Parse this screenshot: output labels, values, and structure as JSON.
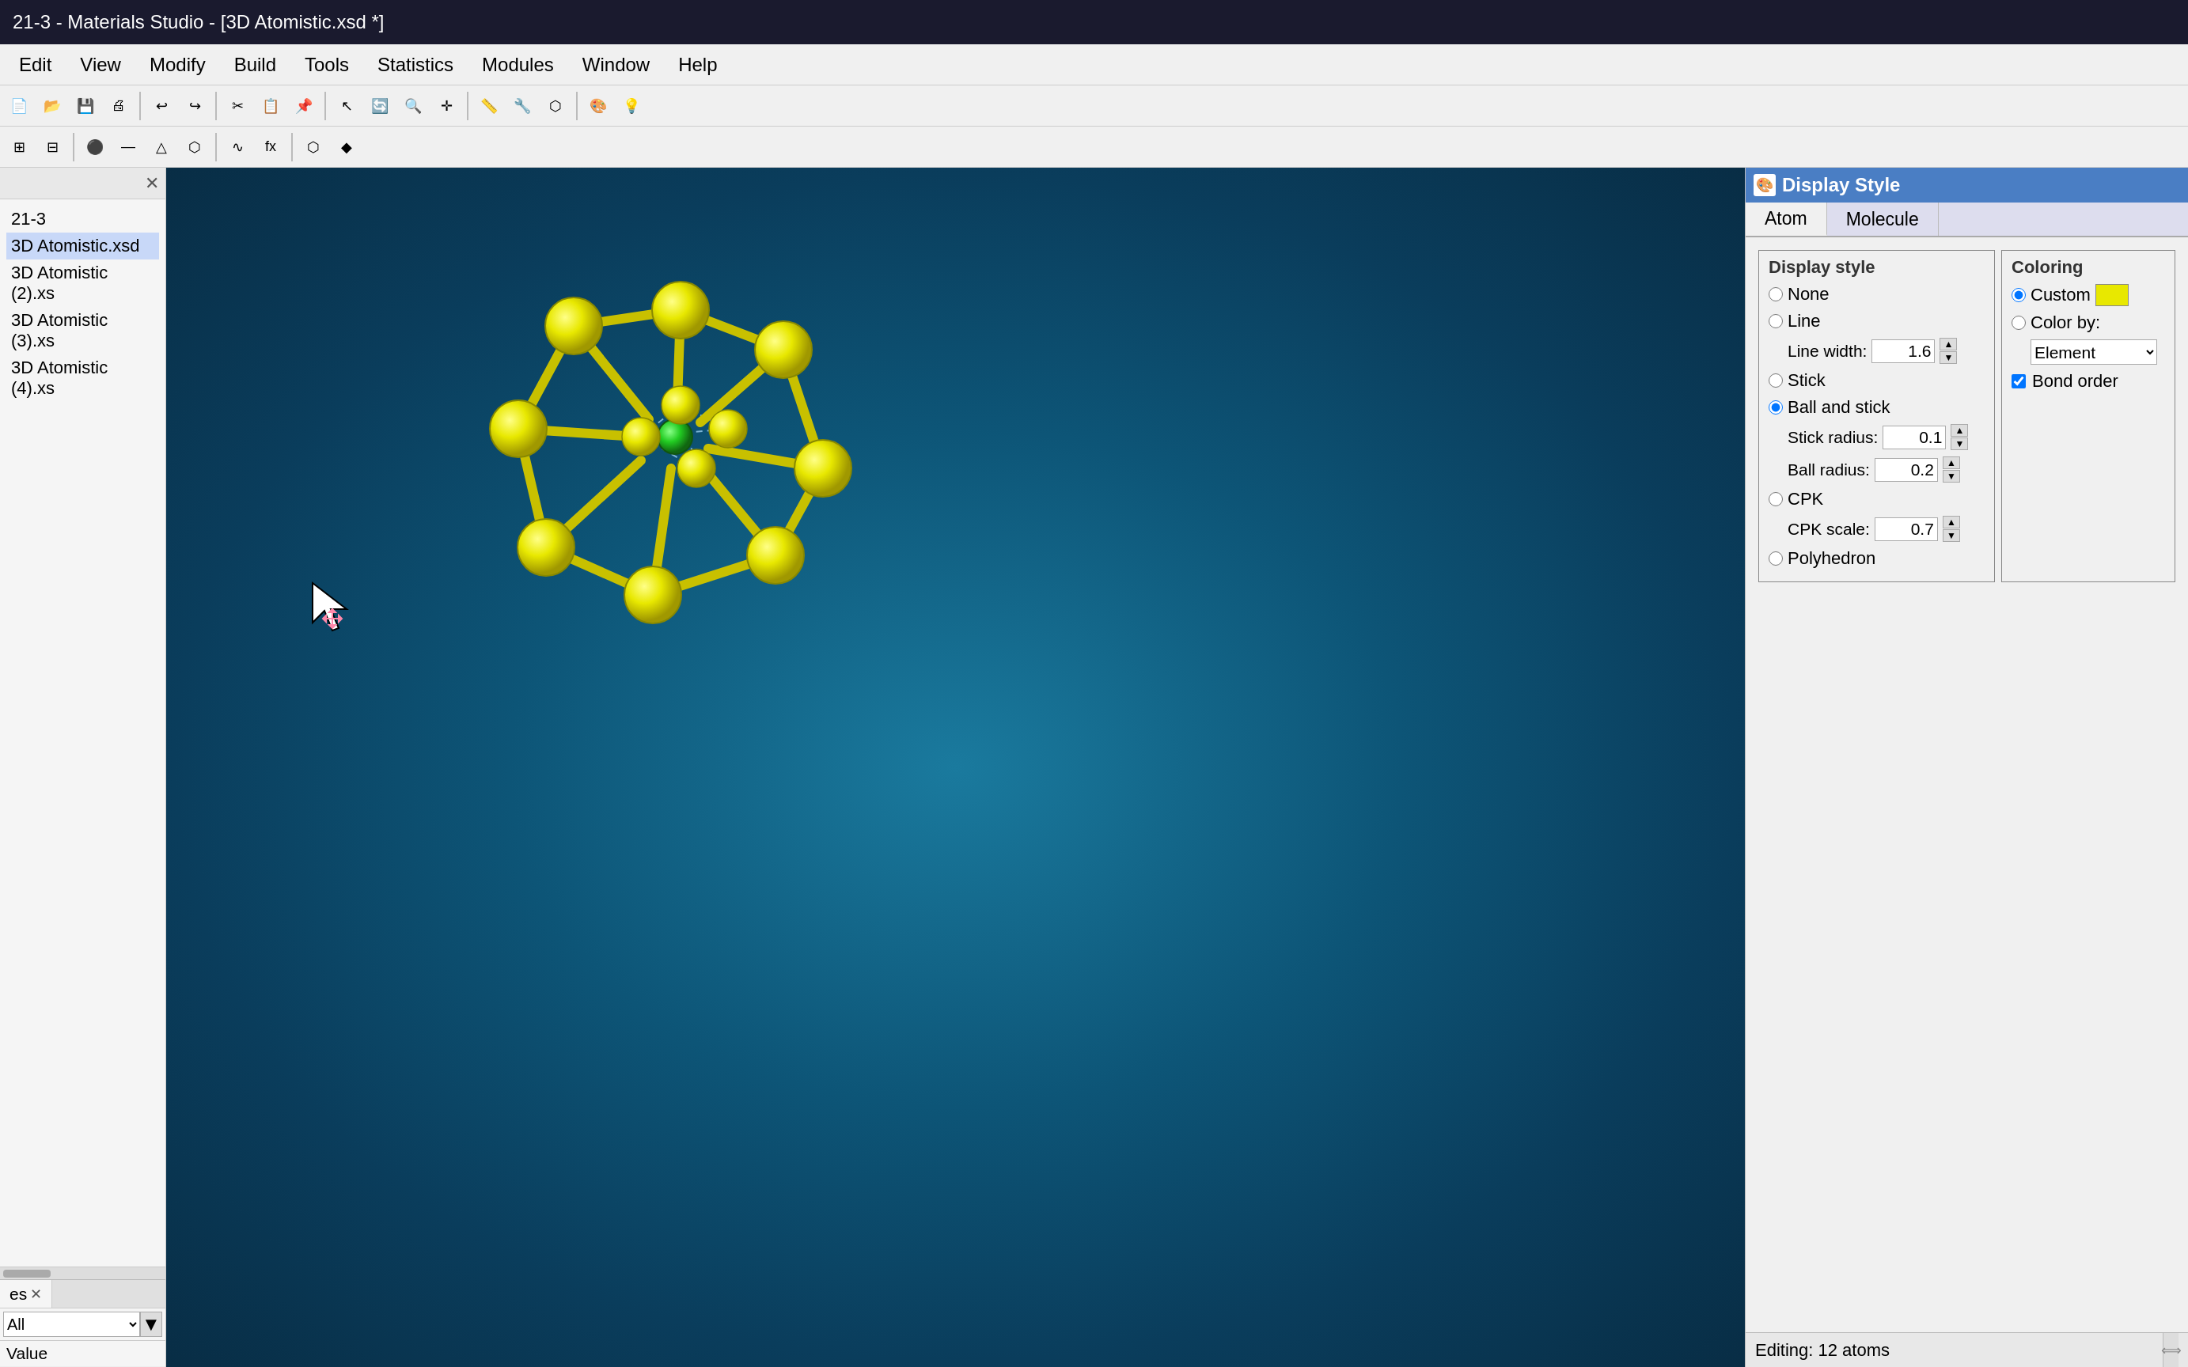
{
  "titlebar": {
    "text": "21-3 - Materials Studio - [3D Atomistic.xsd *]"
  },
  "menubar": {
    "items": [
      "Edit",
      "View",
      "Modify",
      "Build",
      "Tools",
      "Statistics",
      "Modules",
      "Window",
      "Help"
    ]
  },
  "leftpanel": {
    "files": [
      {
        "name": "21-3"
      },
      {
        "name": "3D Atomistic.xsd",
        "active": true
      },
      {
        "name": "3D Atomistic (2).xs"
      },
      {
        "name": "3D Atomistic (3).xs"
      },
      {
        "name": "3D Atomistic (4).xs"
      }
    ],
    "tab": "es",
    "filter_value": "All",
    "value_label": "Value"
  },
  "rightpanel": {
    "title": "Display Style",
    "tabs": [
      "Atom",
      "Molecule"
    ],
    "active_tab": "Atom",
    "display_style_section": "Display style",
    "coloring_section": "Coloring",
    "options": {
      "none": "None",
      "line": "Line",
      "line_width_label": "Line width:",
      "line_width_value": "1.6",
      "stick": "Stick",
      "ball_and_stick": "Ball and stick",
      "stick_radius_label": "Stick radius:",
      "stick_radius_value": "0.1",
      "ball_radius_label": "Ball radius:",
      "ball_radius_value": "0.2",
      "cpk": "CPK",
      "cpk_scale_label": "CPK scale:",
      "cpk_scale_value": "0.7",
      "polyhedron": "Polyhedron",
      "selected": "ball_and_stick"
    },
    "coloring": {
      "custom": "Custom",
      "color_by": "Color by:",
      "color_by_value": "Element",
      "bond_order": "Bond order"
    },
    "footer": {
      "text": "Editing: 12 atoms"
    }
  }
}
